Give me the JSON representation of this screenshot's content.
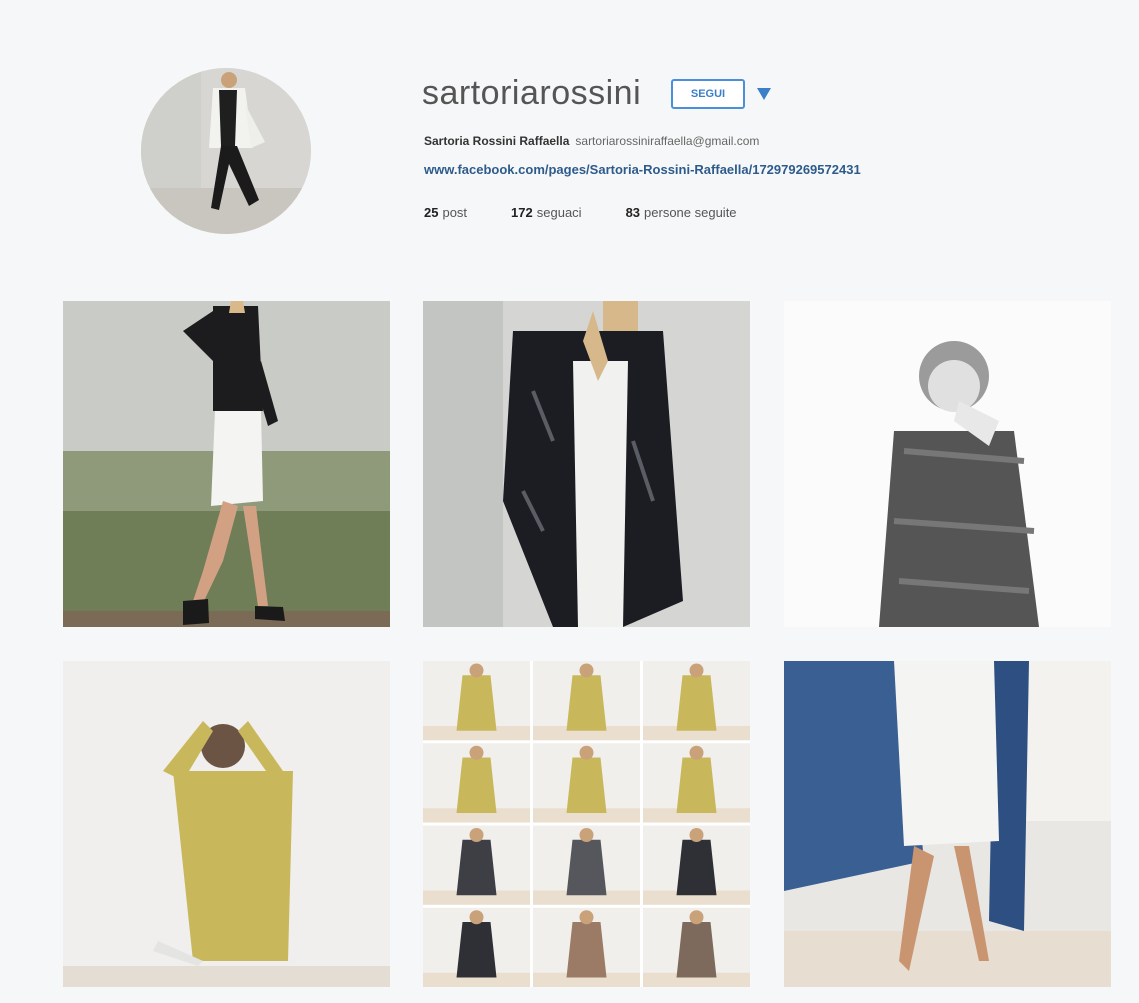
{
  "profile": {
    "username": "sartoriarossini",
    "follow_label": "SEGUI",
    "dropdown_icon": "caret-down-icon",
    "full_name": "Sartoria Rossini Raffaella",
    "email": "sartoriarossiniraffaella@gmail.com",
    "website": "www.facebook.com/pages/Sartoria-Rossini-Raffaella/172979269572431",
    "stats": {
      "posts_count": "25",
      "posts_label": "post",
      "followers_count": "172",
      "followers_label": "seguaci",
      "following_count": "83",
      "following_label": "persone seguite"
    }
  },
  "colors": {
    "accent": "#3b7fc8",
    "link": "#2d5b8c",
    "background": "#f6f7f8"
  },
  "posts": [
    {
      "description_icon": "photo-woman-walking-black-sweater"
    },
    {
      "description_icon": "photo-woman-fur-coat"
    },
    {
      "description_icon": "photo-woman-grey-wool-coat"
    },
    {
      "description_icon": "photo-woman-yellow-dress"
    },
    {
      "description_icon": "photo-collage-grid"
    },
    {
      "description_icon": "photo-woman-blue-cape"
    }
  ]
}
